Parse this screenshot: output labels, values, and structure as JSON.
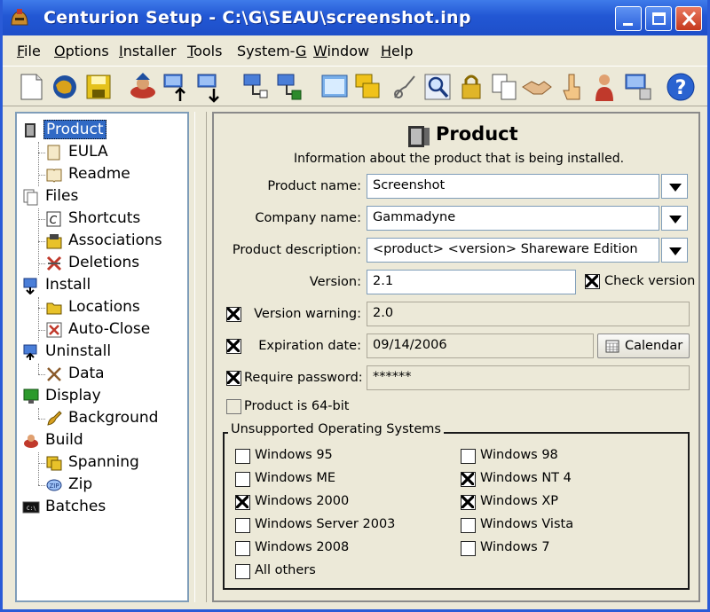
{
  "window": {
    "title": "Centurion Setup - C:\\G\\SEAU\\screenshot.inp"
  },
  "titlebar_buttons": [
    "minimize-icon",
    "maximize-icon",
    "close-icon"
  ],
  "menu": [
    "File",
    "Options",
    "Installer",
    "Tools",
    "System-G",
    "Window",
    "Help"
  ],
  "toolbar": [
    "new-file-icon",
    "open-icon",
    "save-icon",
    "wizard-icon",
    "import-icon",
    "export-icon",
    "network-import-icon",
    "network-export-icon",
    "preview-icon",
    "windows-icon",
    "probe-icon",
    "search-icon",
    "lock-icon",
    "copy-icon",
    "handshake-icon",
    "pointer-icon",
    "person-icon",
    "computer-icon",
    "help-icon"
  ],
  "tree": {
    "items": [
      {
        "label": "Product",
        "icon": "product-icon",
        "selected": true
      },
      {
        "label": "EULA",
        "icon": "document-icon"
      },
      {
        "label": "Readme",
        "icon": "book-icon"
      },
      {
        "label": "Files",
        "icon": "files-icon"
      },
      {
        "label": "Shortcuts",
        "icon": "shortcut-icon"
      },
      {
        "label": "Associations",
        "icon": "association-icon"
      },
      {
        "label": "Deletions",
        "icon": "delete-icon"
      },
      {
        "label": "Install",
        "icon": "install-icon"
      },
      {
        "label": "Locations",
        "icon": "folder-icon"
      },
      {
        "label": "Auto-Close",
        "icon": "autoclose-icon"
      },
      {
        "label": "Uninstall",
        "icon": "uninstall-icon"
      },
      {
        "label": "Data",
        "icon": "data-icon"
      },
      {
        "label": "Display",
        "icon": "monitor-icon"
      },
      {
        "label": "Background",
        "icon": "paint-icon"
      },
      {
        "label": "Build",
        "icon": "build-icon"
      },
      {
        "label": "Spanning",
        "icon": "spanning-icon"
      },
      {
        "label": "Zip",
        "icon": "zip-icon"
      },
      {
        "label": "Batches",
        "icon": "batch-icon"
      }
    ]
  },
  "panel": {
    "heading": "Product",
    "subtitle": "Information about the product that is being installed.",
    "product_name": {
      "label": "Product name:",
      "value": "Screenshot"
    },
    "company_name": {
      "label": "Company name:",
      "value": "Gammadyne"
    },
    "product_description": {
      "label": "Product description:",
      "value": "<product> <version> Shareware Edition"
    },
    "version": {
      "label": "Version:",
      "value": "2.1"
    },
    "check_version": {
      "label": "Check version",
      "checked": true
    },
    "version_warning": {
      "label": "Version warning:",
      "value": "2.0",
      "checked": true
    },
    "expiration_date": {
      "label": "Expiration date:",
      "value": "09/14/2006",
      "checked": true
    },
    "calendar_button": "Calendar",
    "require_password": {
      "label": "Require password:",
      "value": "******",
      "checked": true
    },
    "is_64bit": {
      "label": "Product is 64-bit",
      "checked": false
    },
    "unsupported": {
      "title": "Unsupported Operating Systems",
      "left": [
        {
          "label": "Windows 95",
          "checked": false
        },
        {
          "label": "Windows ME",
          "checked": false
        },
        {
          "label": "Windows 2000",
          "checked": true
        },
        {
          "label": "Windows Server 2003",
          "checked": false
        },
        {
          "label": "Windows 2008",
          "checked": false
        },
        {
          "label": "All others",
          "checked": false
        }
      ],
      "right": [
        {
          "label": "Windows 98",
          "checked": false
        },
        {
          "label": "Windows NT 4",
          "checked": true
        },
        {
          "label": "Windows XP",
          "checked": true
        },
        {
          "label": "Windows Vista",
          "checked": false
        },
        {
          "label": "Windows 7",
          "checked": false
        }
      ]
    }
  },
  "colors": {
    "titlebar": "#2257d4",
    "selection": "#316ac5",
    "window_bg": "#ece9d8"
  }
}
